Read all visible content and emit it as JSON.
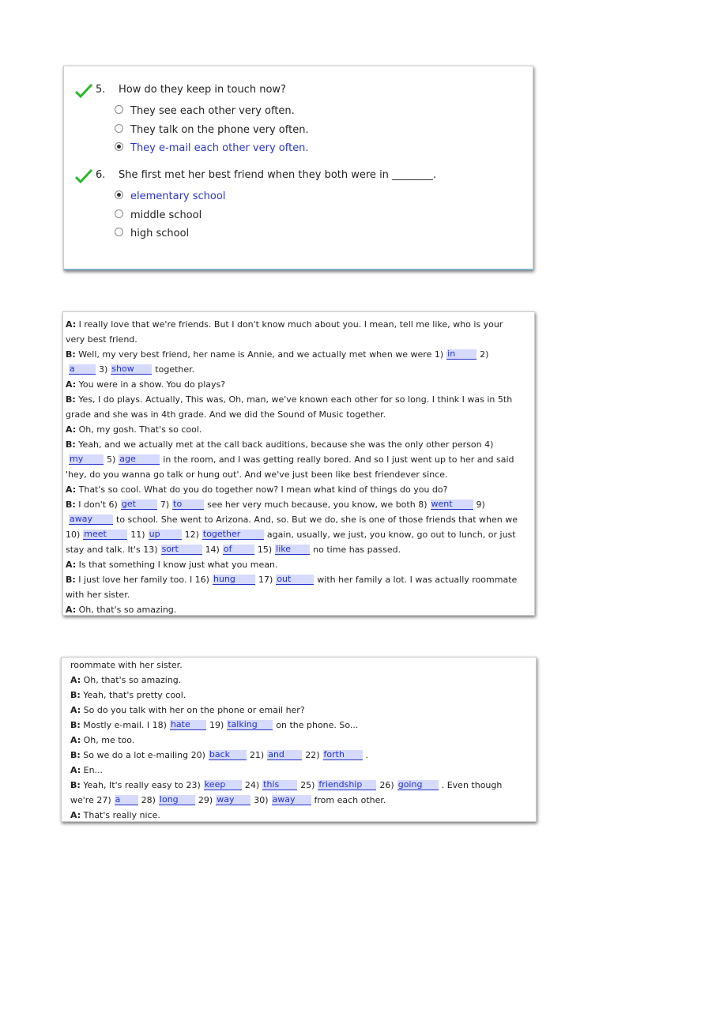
{
  "quiz": {
    "questions": [
      {
        "number": "5.",
        "text": "How do they keep in touch now?",
        "correct": true,
        "options": [
          {
            "label": "They see each other very often.",
            "selected": false
          },
          {
            "label": "They talk on the phone very often.",
            "selected": false
          },
          {
            "label": "They e-mail each other very often.",
            "selected": true
          }
        ]
      },
      {
        "number": "6.",
        "text": "She first met her best friend when they both were in ________.",
        "correct": true,
        "options": [
          {
            "label": "elementary school",
            "selected": true
          },
          {
            "label": "middle school",
            "selected": false
          },
          {
            "label": "high school",
            "selected": false
          }
        ]
      }
    ]
  },
  "colors": {
    "selected": "#2a35c9",
    "blank_bg": "#d6dafc",
    "check": "#2eb82e"
  },
  "dialog_panel_1": [
    [
      {
        "s": "A:"
      },
      {
        "t": " I really love that we're friends. But I don't know much about you. I mean, tell me like, who is your very best friend."
      }
    ],
    [
      {
        "s": "B:"
      },
      {
        "t": " Well, my very best friend, her name is Annie, and we actually met when we were 1)"
      },
      {
        "b": "in",
        "w": 36
      },
      {
        "t": "2)"
      },
      {
        "b": "a",
        "w": 32
      },
      {
        "t": "3)"
      },
      {
        "b": "show",
        "w": 50
      },
      {
        "t": "together."
      }
    ],
    [
      {
        "s": "A:"
      },
      {
        "t": " You were in a show. You do plays?"
      }
    ],
    [
      {
        "s": "B:"
      },
      {
        "t": " Yes, I do plays. Actually, This was, Oh, man, we've known each other for so long. I think I was in 5th grade and she was in 4th grade. And we did the Sound of Music together."
      }
    ],
    [
      {
        "s": "A:"
      },
      {
        "t": " Oh, my gosh. That's so cool."
      }
    ],
    [
      {
        "s": "B:"
      },
      {
        "t": " Yeah, and we actually met at the call back auditions, because she was the only other person 4)"
      },
      {
        "b": "my",
        "w": 42
      },
      {
        "t": "5)"
      },
      {
        "b": "age",
        "w": 50
      },
      {
        "t": "in the room, and I was getting really bored. And so I just went up to her and said 'hey, do you wanna go talk or hung out'. And we've just been like best friendever since."
      }
    ],
    [
      {
        "s": "A:"
      },
      {
        "t": " That's so cool. What do you do together now? I mean what kind of things do you do?"
      }
    ],
    [
      {
        "s": "B:"
      },
      {
        "t": " I don't 6)"
      },
      {
        "b": "get",
        "w": 44
      },
      {
        "t": "7)"
      },
      {
        "b": "to",
        "w": 38
      },
      {
        "t": "see her very much because, you know, we both 8)"
      },
      {
        "b": "went",
        "w": 52
      },
      {
        "t": "9)"
      },
      {
        "b": "away",
        "w": 54
      },
      {
        "t": "to school. She went to Arizona. And, so. But we do, she is one of those friends that when we 10)"
      },
      {
        "b": "meet",
        "w": 54
      },
      {
        "t": "11)"
      },
      {
        "b": "up",
        "w": 40
      },
      {
        "t": "12)"
      },
      {
        "b": "together",
        "w": 76
      },
      {
        "t": "again, usually, we just, you know, go out to lunch, or just stay and talk. It's 13)"
      },
      {
        "b": "sort",
        "w": 50
      },
      {
        "t": "14)"
      },
      {
        "b": "of",
        "w": 38
      },
      {
        "t": "15)"
      },
      {
        "b": "like",
        "w": 42
      },
      {
        "t": "no time has passed."
      }
    ],
    [
      {
        "s": "A:"
      },
      {
        "t": " Is that something I know just what you mean."
      }
    ],
    [
      {
        "s": "B:"
      },
      {
        "t": " I just love her family too. I 16)"
      },
      {
        "b": "hung",
        "w": 52
      },
      {
        "t": "17)"
      },
      {
        "b": "out",
        "w": 46
      },
      {
        "t": "with her family a lot. I was actually roommate with her sister."
      }
    ],
    [
      {
        "s": "A:"
      },
      {
        "t": " Oh, that's so amazing."
      }
    ]
  ],
  "dialog_panel_2": [
    [
      {
        "t": "roommate with her sister."
      }
    ],
    [
      {
        "s": "A:"
      },
      {
        "t": " Oh, that's so amazing."
      }
    ],
    [
      {
        "s": "B:"
      },
      {
        "t": " Yeah, that's pretty cool."
      }
    ],
    [
      {
        "s": "A:"
      },
      {
        "t": " So do you talk with her on the phone or email her?"
      }
    ],
    [
      {
        "s": "B:"
      },
      {
        "t": " Mostly e-mail. I 18)"
      },
      {
        "b": "hate",
        "w": 44
      },
      {
        "t": "19)"
      },
      {
        "b": "talking",
        "w": 56
      },
      {
        "t": "on the phone. So..."
      }
    ],
    [
      {
        "s": "A:"
      },
      {
        "t": " Oh, me too."
      }
    ],
    [
      {
        "s": "B:"
      },
      {
        "t": " So we do a lot e-mailing 20)"
      },
      {
        "b": "back",
        "w": 46
      },
      {
        "t": "21)"
      },
      {
        "b": "and",
        "w": 42
      },
      {
        "t": "22)"
      },
      {
        "b": "forth",
        "w": 48
      },
      {
        "t": "."
      }
    ],
    [
      {
        "s": "A:"
      },
      {
        "t": " En..."
      }
    ],
    [
      {
        "s": "B:"
      },
      {
        "t": " Yeah, It's really easy to 23)"
      },
      {
        "b": "keep",
        "w": 46
      },
      {
        "t": "24)"
      },
      {
        "b": "this",
        "w": 42
      },
      {
        "t": "25)"
      },
      {
        "b": "friendship",
        "w": 72
      },
      {
        "t": "26)"
      },
      {
        "b": "going",
        "w": 50
      },
      {
        "t": ". Even though we're 27)"
      },
      {
        "b": "a",
        "w": 28
      },
      {
        "t": "28)"
      },
      {
        "b": "long",
        "w": 44
      },
      {
        "t": "29)"
      },
      {
        "b": "way",
        "w": 42
      },
      {
        "t": "30)"
      },
      {
        "b": "away",
        "w": 48
      },
      {
        "t": "from each other."
      }
    ],
    [
      {
        "s": "A:"
      },
      {
        "t": " That's really nice."
      }
    ]
  ]
}
